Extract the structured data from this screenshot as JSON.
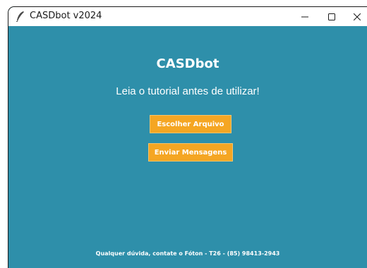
{
  "window": {
    "title": "CASDbot v2024",
    "icon": "feather-icon",
    "controls": {
      "minimize_icon": "minimize-icon",
      "maximize_icon": "maximize-icon",
      "close_icon": "close-icon"
    }
  },
  "main": {
    "heading": "CASDbot",
    "subtitle": "Leia o tutorial antes de utilizar!",
    "buttons": {
      "choose_file": "Escolher Arquivo",
      "send_messages": "Enviar Mensagens"
    },
    "footer": "Qualquer dúvida, contate o Fóton - T26 - (85) 98413-2943"
  },
  "colors": {
    "background": "#2e8faa",
    "button": "#f5a623",
    "text": "#ffffff"
  }
}
